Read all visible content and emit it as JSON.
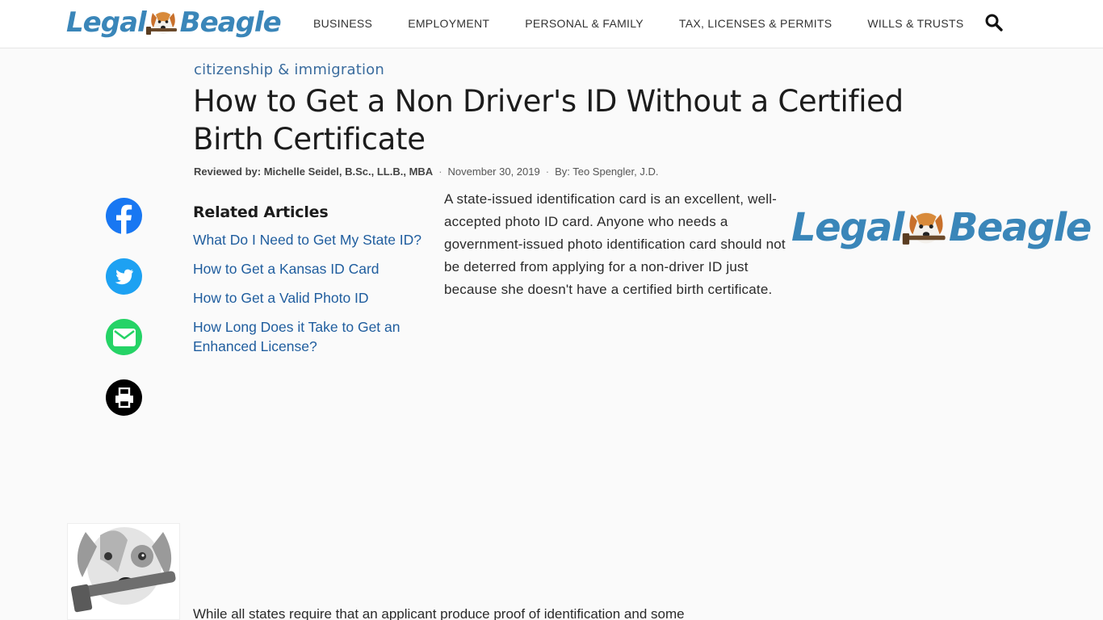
{
  "header": {
    "logo_left": "Legal",
    "logo_right": "Beagle",
    "nav": [
      {
        "label": "BUSINESS"
      },
      {
        "label": "EMPLOYMENT"
      },
      {
        "label": "PERSONAL & FAMILY"
      },
      {
        "label": "TAX, LICENSES & PERMITS"
      },
      {
        "label": "WILLS & TRUSTS"
      }
    ],
    "search_icon": "search-icon"
  },
  "article": {
    "category": "citizenship & immigration",
    "title": "How to Get a Non Driver's ID Without a Certified Birth Certificate",
    "reviewer": "Reviewed by: Michelle Seidel, B.Sc., LL.B., MBA",
    "separator": "·",
    "date": "November 30, 2019",
    "author": "By: Teo Spengler, J.D.",
    "intro": "A state-issued identification card is an excellent, well-accepted photo ID card. Anyone who needs a government-issued photo identification card should not be deterred from applying for a non-driver ID just because she doesn't have a certified birth certificate.",
    "paragraph2": "While all states require that an applicant produce proof of identification and some"
  },
  "share": {
    "icons": [
      "facebook-icon",
      "twitter-icon",
      "email-icon",
      "print-icon"
    ],
    "colors": {
      "facebook": "#1877f2",
      "twitter": "#1da1f2",
      "email": "#25d366",
      "print": "#000000"
    }
  },
  "related": {
    "heading": "Related Articles",
    "items": [
      {
        "label": "What Do I Need to Get My State ID?"
      },
      {
        "label": "How to Get a Kansas ID Card"
      },
      {
        "label": "How to Get a Valid Photo ID"
      },
      {
        "label": "How Long Does it Take to Get an Enhanced License?"
      }
    ]
  },
  "colors": {
    "brand": "#3a86b9",
    "link": "#1f5d9e"
  }
}
